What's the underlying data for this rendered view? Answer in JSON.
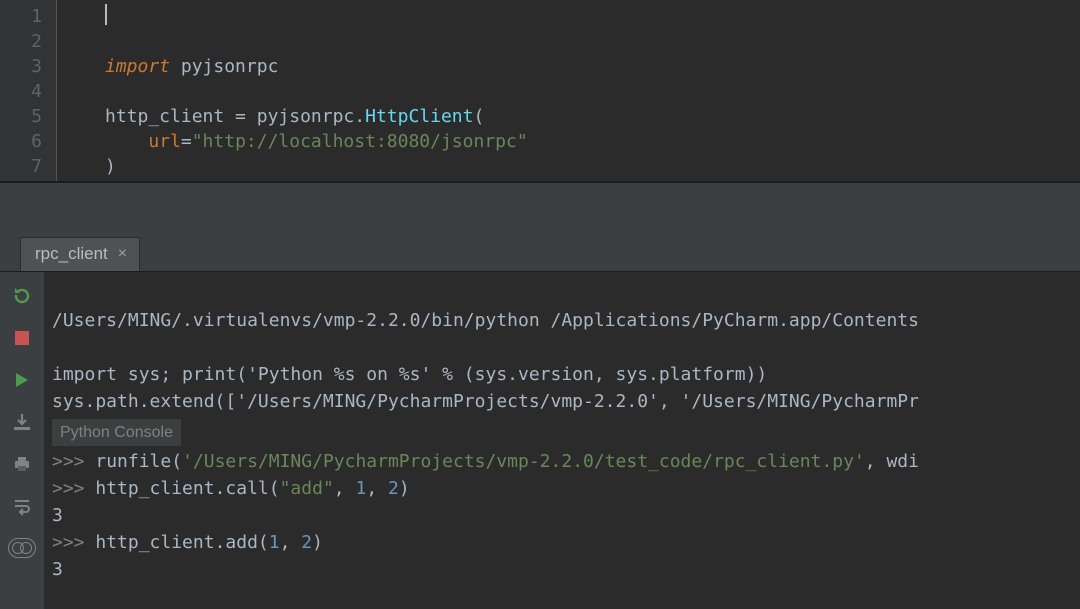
{
  "editor": {
    "line_numbers": [
      "1",
      "2",
      "3",
      "4",
      "5",
      "6",
      "7"
    ],
    "code": {
      "l1_import": "import",
      "l1_module": " pyjsonrpc",
      "l3_lhs": "http_client ",
      "l3_eq": "=",
      "l3_mod": " pyjsonrpc",
      "l3_dot": ".",
      "l3_cls": "HttpClient",
      "l3_open": "(",
      "l4_indent": "    ",
      "l4_param": "url",
      "l4_eq": "=",
      "l4_str": "\"http://localhost:8080/jsonrpc\"",
      "l5_close": ")"
    }
  },
  "tab": {
    "label": "rpc_client",
    "close": "×"
  },
  "console": {
    "line1": "/Users/MING/.virtualenvs/vmp-2.2.0/bin/python /Applications/PyCharm.app/Contents",
    "line2": "import sys; print('Python %s on %s' % (sys.version, sys.platform))",
    "line3": "sys.path.extend(['/Users/MING/PycharmProjects/vmp-2.2.0', '/Users/MING/PycharmPr",
    "header": "Python Console",
    "p": ">>> ",
    "r1_a": "runfile(",
    "r1_b": "'/Users/MING/PycharmProjects/vmp-2.2.0/test_code/rpc_client.py'",
    "r1_c": ", wdi",
    "r2_a": "http_client.call(",
    "r2_b": "\"add\"",
    "r2_c": ", ",
    "r2_d": "1",
    "r2_e": ", ",
    "r2_f": "2",
    "r2_g": ")",
    "out1": "3",
    "r3_a": "http_client.add(",
    "r3_b": "1",
    "r3_c": ", ",
    "r3_d": "2",
    "r3_e": ")",
    "out2": "3"
  }
}
